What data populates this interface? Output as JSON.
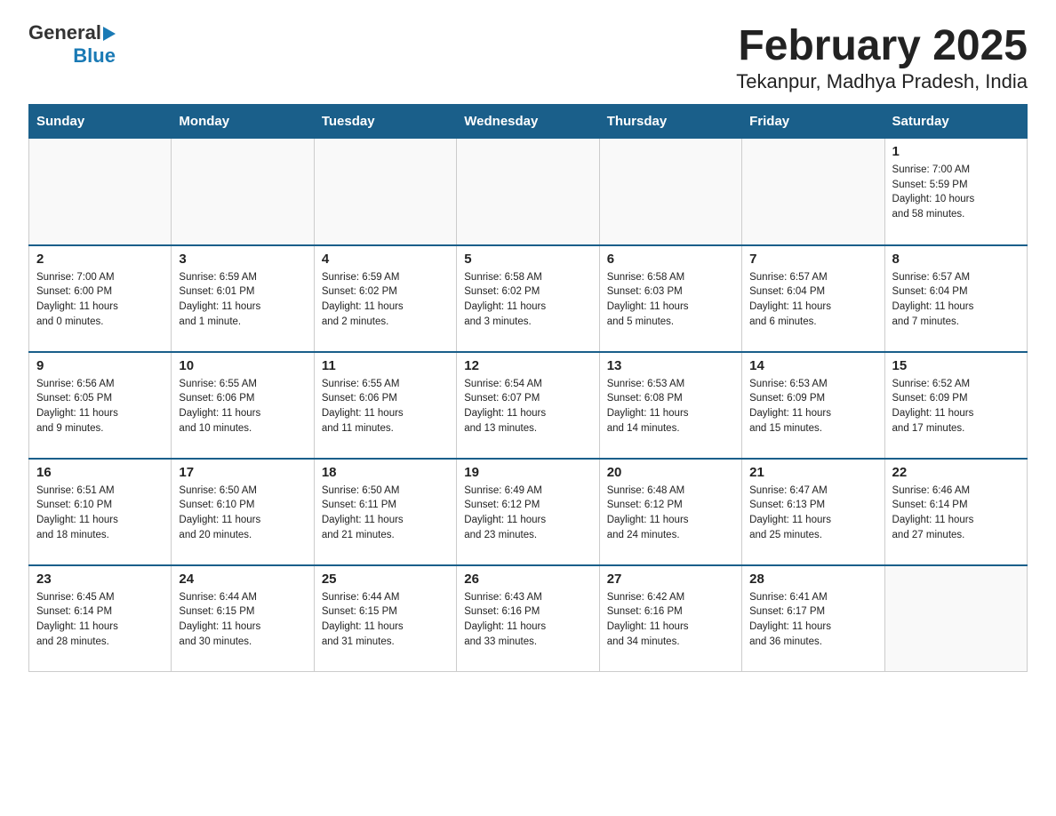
{
  "logo": {
    "general": "General",
    "arrow": "▶",
    "blue": "Blue"
  },
  "title": "February 2025",
  "subtitle": "Tekanpur, Madhya Pradesh, India",
  "weekdays": [
    "Sunday",
    "Monday",
    "Tuesday",
    "Wednesday",
    "Thursday",
    "Friday",
    "Saturday"
  ],
  "weeks": [
    [
      {
        "day": "",
        "info": ""
      },
      {
        "day": "",
        "info": ""
      },
      {
        "day": "",
        "info": ""
      },
      {
        "day": "",
        "info": ""
      },
      {
        "day": "",
        "info": ""
      },
      {
        "day": "",
        "info": ""
      },
      {
        "day": "1",
        "info": "Sunrise: 7:00 AM\nSunset: 5:59 PM\nDaylight: 10 hours\nand 58 minutes."
      }
    ],
    [
      {
        "day": "2",
        "info": "Sunrise: 7:00 AM\nSunset: 6:00 PM\nDaylight: 11 hours\nand 0 minutes."
      },
      {
        "day": "3",
        "info": "Sunrise: 6:59 AM\nSunset: 6:01 PM\nDaylight: 11 hours\nand 1 minute."
      },
      {
        "day": "4",
        "info": "Sunrise: 6:59 AM\nSunset: 6:02 PM\nDaylight: 11 hours\nand 2 minutes."
      },
      {
        "day": "5",
        "info": "Sunrise: 6:58 AM\nSunset: 6:02 PM\nDaylight: 11 hours\nand 3 minutes."
      },
      {
        "day": "6",
        "info": "Sunrise: 6:58 AM\nSunset: 6:03 PM\nDaylight: 11 hours\nand 5 minutes."
      },
      {
        "day": "7",
        "info": "Sunrise: 6:57 AM\nSunset: 6:04 PM\nDaylight: 11 hours\nand 6 minutes."
      },
      {
        "day": "8",
        "info": "Sunrise: 6:57 AM\nSunset: 6:04 PM\nDaylight: 11 hours\nand 7 minutes."
      }
    ],
    [
      {
        "day": "9",
        "info": "Sunrise: 6:56 AM\nSunset: 6:05 PM\nDaylight: 11 hours\nand 9 minutes."
      },
      {
        "day": "10",
        "info": "Sunrise: 6:55 AM\nSunset: 6:06 PM\nDaylight: 11 hours\nand 10 minutes."
      },
      {
        "day": "11",
        "info": "Sunrise: 6:55 AM\nSunset: 6:06 PM\nDaylight: 11 hours\nand 11 minutes."
      },
      {
        "day": "12",
        "info": "Sunrise: 6:54 AM\nSunset: 6:07 PM\nDaylight: 11 hours\nand 13 minutes."
      },
      {
        "day": "13",
        "info": "Sunrise: 6:53 AM\nSunset: 6:08 PM\nDaylight: 11 hours\nand 14 minutes."
      },
      {
        "day": "14",
        "info": "Sunrise: 6:53 AM\nSunset: 6:09 PM\nDaylight: 11 hours\nand 15 minutes."
      },
      {
        "day": "15",
        "info": "Sunrise: 6:52 AM\nSunset: 6:09 PM\nDaylight: 11 hours\nand 17 minutes."
      }
    ],
    [
      {
        "day": "16",
        "info": "Sunrise: 6:51 AM\nSunset: 6:10 PM\nDaylight: 11 hours\nand 18 minutes."
      },
      {
        "day": "17",
        "info": "Sunrise: 6:50 AM\nSunset: 6:10 PM\nDaylight: 11 hours\nand 20 minutes."
      },
      {
        "day": "18",
        "info": "Sunrise: 6:50 AM\nSunset: 6:11 PM\nDaylight: 11 hours\nand 21 minutes."
      },
      {
        "day": "19",
        "info": "Sunrise: 6:49 AM\nSunset: 6:12 PM\nDaylight: 11 hours\nand 23 minutes."
      },
      {
        "day": "20",
        "info": "Sunrise: 6:48 AM\nSunset: 6:12 PM\nDaylight: 11 hours\nand 24 minutes."
      },
      {
        "day": "21",
        "info": "Sunrise: 6:47 AM\nSunset: 6:13 PM\nDaylight: 11 hours\nand 25 minutes."
      },
      {
        "day": "22",
        "info": "Sunrise: 6:46 AM\nSunset: 6:14 PM\nDaylight: 11 hours\nand 27 minutes."
      }
    ],
    [
      {
        "day": "23",
        "info": "Sunrise: 6:45 AM\nSunset: 6:14 PM\nDaylight: 11 hours\nand 28 minutes."
      },
      {
        "day": "24",
        "info": "Sunrise: 6:44 AM\nSunset: 6:15 PM\nDaylight: 11 hours\nand 30 minutes."
      },
      {
        "day": "25",
        "info": "Sunrise: 6:44 AM\nSunset: 6:15 PM\nDaylight: 11 hours\nand 31 minutes."
      },
      {
        "day": "26",
        "info": "Sunrise: 6:43 AM\nSunset: 6:16 PM\nDaylight: 11 hours\nand 33 minutes."
      },
      {
        "day": "27",
        "info": "Sunrise: 6:42 AM\nSunset: 6:16 PM\nDaylight: 11 hours\nand 34 minutes."
      },
      {
        "day": "28",
        "info": "Sunrise: 6:41 AM\nSunset: 6:17 PM\nDaylight: 11 hours\nand 36 minutes."
      },
      {
        "day": "",
        "info": ""
      }
    ]
  ]
}
